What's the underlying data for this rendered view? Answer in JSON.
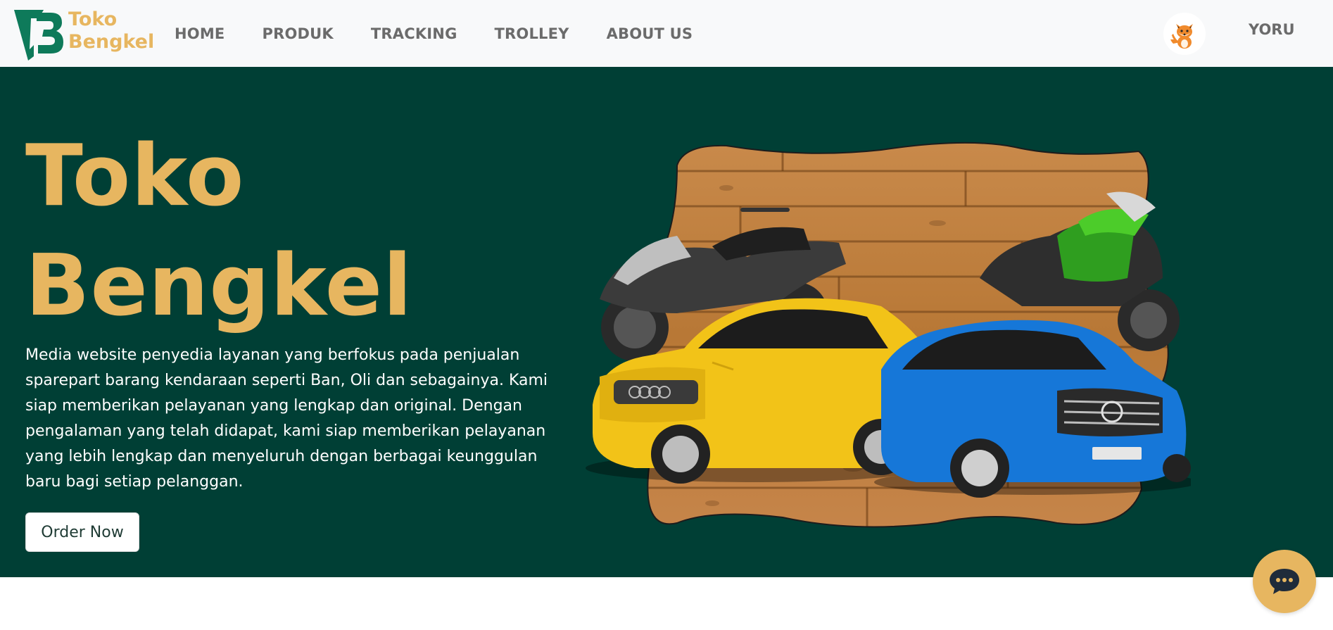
{
  "brand": {
    "name_line1": "Toko",
    "name_line2": "Bengkel",
    "logo_icon": "tb-logo-icon",
    "logo_color": "#0e7a5a",
    "text_color": "#e7b660"
  },
  "nav": {
    "links": [
      {
        "label": "HOME"
      },
      {
        "label": "PRODUK"
      },
      {
        "label": "TRACKING"
      },
      {
        "label": "TROLLEY"
      },
      {
        "label": "ABOUT US"
      }
    ],
    "avatar_icon": "fox-avatar-icon",
    "username": "YORU"
  },
  "hero": {
    "title_line1": "Toko",
    "title_line2": "Bengkel",
    "description": "Media website penyedia layanan yang berfokus pada penjualan sparepart barang kendaraan seperti Ban, Oli dan sebagainya. Kami siap memberikan pelayanan yang lengkap dan original. Dengan pengalaman yang telah didapat, kami siap memberikan pelayanan yang lebih lengkap dan menyeluruh dengan berbagai keunggulan baru bagi setiap pelanggan.",
    "cta_label": "Order Now",
    "illustration": "vehicles-on-wood-blob-illustration",
    "background_color": "#003f35",
    "title_color": "#e7b660"
  },
  "chat": {
    "icon": "chat-bubble-icon",
    "color": "#e7b660"
  }
}
